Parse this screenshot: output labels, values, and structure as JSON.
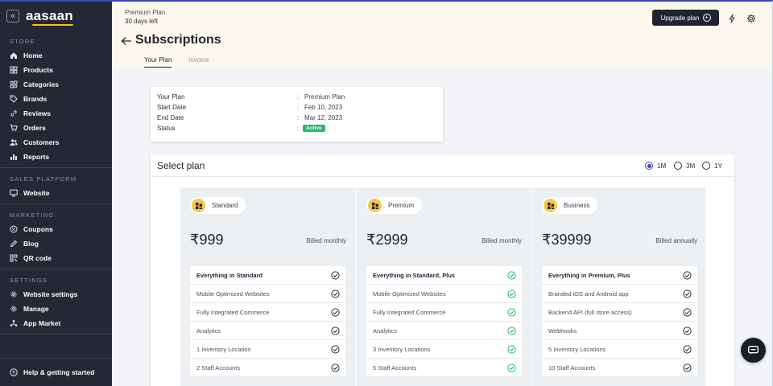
{
  "sidebar": {
    "brand": "aasaan",
    "collapse_glyph": "«",
    "sections": [
      {
        "title": "STORE",
        "items": [
          {
            "label": "Home",
            "icon": "home-icon"
          },
          {
            "label": "Products",
            "icon": "grid-icon"
          },
          {
            "label": "Categories",
            "icon": "categories-icon"
          },
          {
            "label": "Brands",
            "icon": "tag-icon"
          },
          {
            "label": "Reviews",
            "icon": "link-icon"
          },
          {
            "label": "Orders",
            "icon": "cart-icon"
          },
          {
            "label": "Customers",
            "icon": "users-icon"
          },
          {
            "label": "Reports",
            "icon": "bar-chart-icon"
          }
        ]
      },
      {
        "title": "SALES PLATFORM",
        "items": [
          {
            "label": "Website",
            "icon": "monitor-icon"
          }
        ]
      },
      {
        "title": "MARKETING",
        "items": [
          {
            "label": "Coupons",
            "icon": "coupon-icon"
          },
          {
            "label": "Blog",
            "icon": "blog-icon"
          },
          {
            "label": "QR code",
            "icon": "qr-icon"
          }
        ]
      },
      {
        "title": "SETTINGS",
        "items": [
          {
            "label": "Website settings",
            "icon": "gear-icon"
          },
          {
            "label": "Manage",
            "icon": "gear-icon"
          },
          {
            "label": "App Market",
            "icon": "app-market-icon"
          }
        ]
      }
    ],
    "help_label": "Help & getting started"
  },
  "header": {
    "plan_name": "Premium Plan",
    "days_left": "30 days left",
    "upgrade_label": "Upgrade plan",
    "title": "Subscriptions",
    "tabs": [
      "Your Plan",
      "Invoice"
    ]
  },
  "summary": {
    "rows": [
      {
        "label": "Your Plan",
        "value": "Premium Plan"
      },
      {
        "label": "Start Date",
        "value": "Feb 10, 2023"
      },
      {
        "label": "End Date",
        "value": "Mar 12, 2023"
      }
    ],
    "status_label": "Status",
    "status_value": "Active",
    "colon": ":"
  },
  "select_plan": {
    "title": "Select plan",
    "periods": [
      "1M",
      "3M",
      "1Y"
    ],
    "selected_period": "1M",
    "plans": [
      {
        "name": "Standard",
        "price": "₹999",
        "billing": "Billed monthly",
        "check_color": "#2b2f38",
        "features": [
          "Everything in Standard",
          "Mobile Optimized Websites",
          "Fully Integrated Commerce",
          "Analytics",
          "1 Inventory Location",
          "2 Staff Accounts"
        ]
      },
      {
        "name": "Premium",
        "price": "₹2999",
        "billing": "Billed monthly",
        "check_color": "#2bb673",
        "features": [
          "Everything in Standard, Plus",
          "Mobile Optimized Websites",
          "Fully Integrated Commerce",
          "Analytics",
          "3 Inventory Locations",
          "5 Staff Accounts"
        ]
      },
      {
        "name": "Business",
        "price": "₹39999",
        "billing": "Billed annually",
        "check_color": "#2b2f38",
        "features": [
          "Everything in Premium, Plus",
          "Branded iOS and Android app",
          "Backend API (full store access)",
          "Webhooks",
          "5 Inventory Locations",
          "10 Staff Accounts"
        ]
      }
    ]
  },
  "colors": {
    "accent": "#3b4cb8",
    "sidebar_bg": "#232834",
    "active_green": "#2bb673",
    "plan_icon_yellow": "#f7c948"
  }
}
